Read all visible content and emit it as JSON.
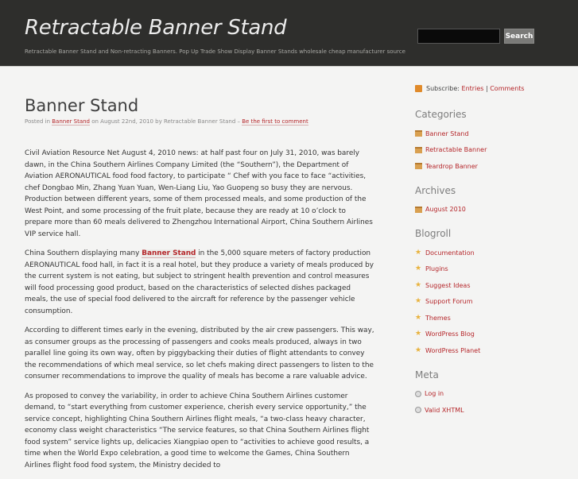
{
  "header": {
    "site_title": "Retractable Banner Stand",
    "site_description": "Retractable Banner Stand and Non-retracting Banners. Pop Up Trade Show Display Banner Stands wholesale cheap manufacturer source",
    "search_button": "Search",
    "search_value": ""
  },
  "post": {
    "title": "Banner Stand",
    "meta": {
      "posted_in": "Posted in",
      "category": "Banner Stand",
      "date_by": "on August 22nd, 2010 by Retractable Banner Stand –",
      "comment_link": "Be the first to comment"
    },
    "paragraphs": [
      "Civil Aviation Resource Net August 4, 2010 news: at half past four on July 31, 2010, was barely dawn, in the China Southern Airlines Company Limited (the “Southern”), the Department of Aviation AERONAUTICAL food food factory, to participate “ Chef with you face to face “activities, chef Dongbao Min, Zhang Yuan Yuan, Wen-Liang Liu, Yao Guopeng so busy they are nervous. Production between different years, some of them processed meals, and some production of the West Point, and some processing of the fruit plate, because they are ready at 10 o’clock to prepare more than 60 meals delivered to Zhengzhou International Airport, China Southern Airlines VIP service hall.",
      "According to different times early in the evening, distributed by the air crew passengers. This way, as consumer groups as the processing of passengers and cooks meals produced, always in two parallel line going its own way, often by piggybacking their duties of flight attendants to convey the recommendations of which meal service, so let chefs making direct passengers to listen to the consumer recommendations to improve the quality of meals has become a rare valuable advice.",
      "As proposed to convey the variability, in order to achieve China Southern Airlines customer demand, to “start everything from customer experience, cherish every service opportunity,” the service concept, highlighting China Southern Airlines flight meals, “a two-class heavy character, economy class weight characteristics “The service features, so that China Southern Airlines flight food system” service lights up, delicacies Xiangpiao open to “activities to achieve good results, a time when the World Expo celebration, a good time to welcome the Games, China Southern Airlines flight food food system, the Ministry decided to"
    ],
    "p2_before": "China Southern displaying many",
    "p2_link": "Banner Stand",
    "p2_after": "in the 5,000 square meters of factory production AERONAUTICAL food hall, in fact it is a real hotel, but they produce a variety of meals produced by the current system is not eating, but subject to stringent health prevention and control measures will food processing good product, based on the characteristics of selected dishes packaged meals, the use of special food delivered to the aircraft for reference by the passenger vehicle consumption."
  },
  "sidebar": {
    "subscribe_label": "Subscribe:",
    "entries": "Entries",
    "separator": "|",
    "comments": "Comments",
    "categories_title": "Categories",
    "categories": [
      "Banner Stand",
      "Retractable Banner",
      "Teardrop Banner"
    ],
    "archives_title": "Archives",
    "archives": [
      "August 2010"
    ],
    "blogroll_title": "Blogroll",
    "blogroll": [
      "Documentation",
      "Plugins",
      "Suggest Ideas",
      "Support Forum",
      "Themes",
      "WordPress Blog",
      "WordPress Planet"
    ],
    "meta_title": "Meta",
    "meta": [
      "Log in",
      "Valid XHTML"
    ]
  },
  "icons": {
    "rss": "rss-icon",
    "category": "folder-icon",
    "blogroll": "star-icon",
    "meta": "circle-icon"
  }
}
